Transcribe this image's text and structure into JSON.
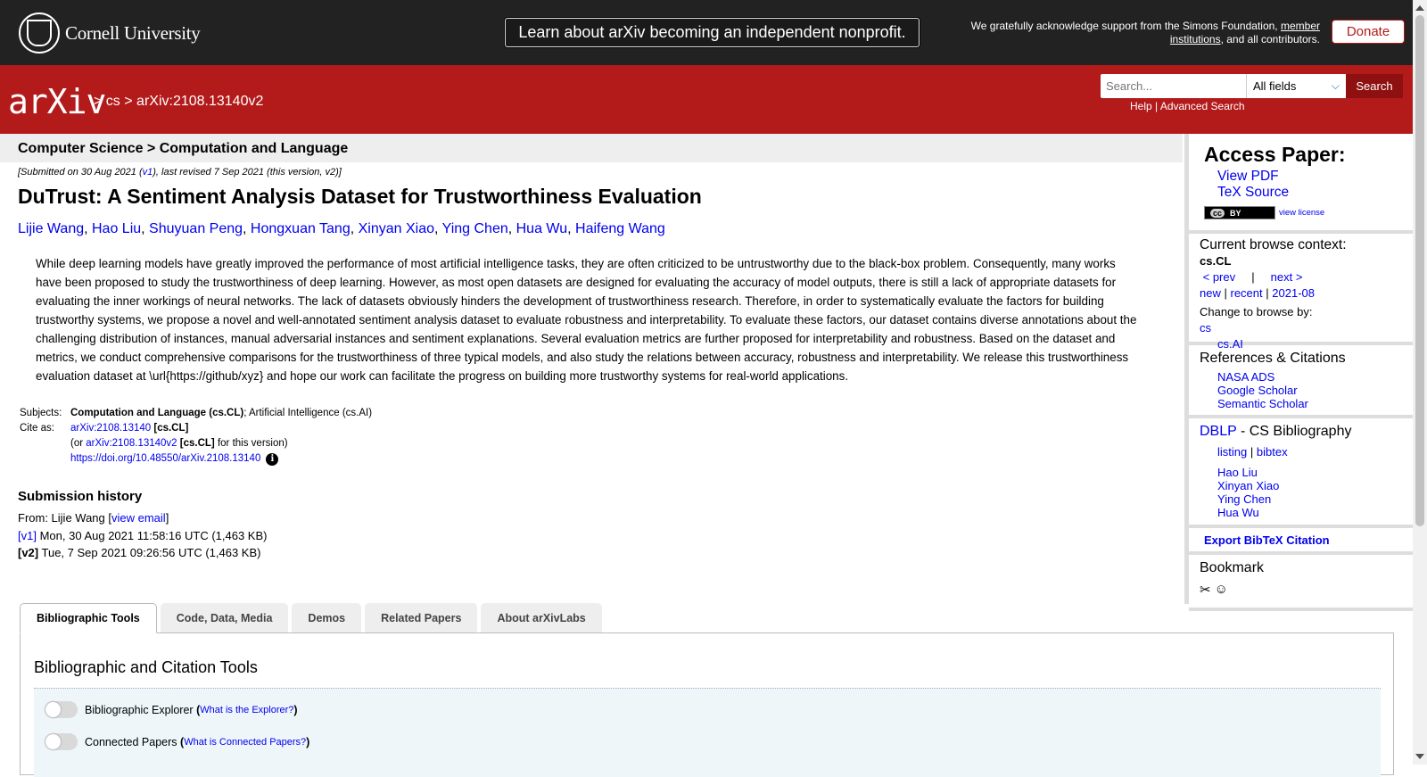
{
  "topbar": {
    "institution": "Cornell University",
    "announcement": "Learn about arXiv becoming an independent nonprofit.",
    "support_text_pre": "We gratefully acknowledge support from the Simons Foundation,",
    "support_link": "member institutions",
    "support_text_post": ", and all contributors.",
    "donate_label": "Donate"
  },
  "header": {
    "logo_text": "arXiv",
    "crumb_sep1": ">",
    "crumb_cs": "cs",
    "crumb_sep2": ">",
    "crumb_id": "arXiv:2108.13140v2",
    "search_placeholder": "Search...",
    "search_field": "All fields",
    "search_button": "Search",
    "help": "Help",
    "sep": "|",
    "advanced": "Advanced Search"
  },
  "paper": {
    "subject_path": "Computer Science > Computation and Language",
    "submitted_pre": "[Submitted on 30 Aug 2021 (",
    "submitted_v1": "v1",
    "submitted_post": "), last revised 7 Sep 2021 (this version, v2)]",
    "title": "DuTrust: A Sentiment Analysis Dataset for Trustworthiness Evaluation",
    "authors": [
      "Lijie Wang",
      "Hao Liu",
      "Shuyuan Peng",
      "Hongxuan Tang",
      "Xinyan Xiao",
      "Ying Chen",
      "Hua Wu",
      "Haifeng Wang"
    ],
    "abstract": "While deep learning models have greatly improved the performance of most artificial intelligence tasks, they are often criticized to be untrustworthy due to the black-box problem. Consequently, many works have been proposed to study the trustworthiness of deep learning. However, as most open datasets are designed for evaluating the accuracy of model outputs, there is still a lack of appropriate datasets for evaluating the inner workings of neural networks. The lack of datasets obviously hinders the development of trustworthiness research. Therefore, in order to systematically evaluate the factors for building trustworthy systems, we propose a novel and well-annotated sentiment analysis dataset to evaluate robustness and interpretability. To evaluate these factors, our dataset contains diverse annotations about the challenging distribution of instances, manual adversarial instances and sentiment explanations. Several evaluation metrics are further proposed for interpretability and robustness. Based on the dataset and metrics, we conduct comprehensive comparisons for the trustworthiness of three typical models, and also study the relations between accuracy, robustness and interpretability. We release this trustworthiness evaluation dataset at \\url{https://github/xyz} and hope our work can facilitate the progress on building more trustworthy systems for real-world applications.",
    "subjects_label": "Subjects:",
    "subjects_primary": "Computation and Language (cs.CL)",
    "subjects_rest": "; Artificial Intelligence (cs.AI)",
    "cite_label": "Cite as:",
    "cite_id": "arXiv:2108.13140",
    "cite_tag": "[cs.CL]",
    "cite_v_pre": "(or",
    "cite_v_id": "arXiv:2108.13140v2",
    "cite_v_tag": "[cs.CL]",
    "cite_v_post": "for this version)",
    "doi": "https://doi.org/10.48550/arXiv.2108.13140",
    "info_glyph": "i"
  },
  "history": {
    "heading": "Submission history",
    "from_pre": "From: Lijie Wang [",
    "from_link": "view email",
    "from_post": "]",
    "v1_tag": "[v1]",
    "v1_text": "Mon, 30 Aug 2021 11:58:16 UTC (1,463 KB)",
    "v2_tag": "[v2]",
    "v2_text": "Tue, 7 Sep 2021 09:26:56 UTC (1,463 KB)"
  },
  "sidebar": {
    "access_heading": "Access Paper:",
    "view_pdf": "View PDF",
    "tex_source": "TeX Source",
    "cc_label": "BY",
    "cc_mark": "cc",
    "view_license": "view license",
    "browse_heading": "Current browse context:",
    "browse_ctx": "cs.CL",
    "prev": "< prev",
    "pipe": "|",
    "next": "next >",
    "new": "new",
    "recent": "recent",
    "date": "2021-08",
    "change_browse": "Change to browse by:",
    "browse_cs": "cs",
    "browse_ai": "cs.AI",
    "refs_heading": "References & Citations",
    "nasa": "NASA ADS",
    "google": "Google Scholar",
    "semantic": "Semantic Scholar",
    "dblp": "DBLP",
    "dblp_rest": " - CS Bibliography",
    "listing": "listing",
    "bibtex": "bibtex",
    "dblp_authors": [
      "Hao Liu",
      "Xinyan Xiao",
      "Ying Chen",
      "Hua Wu"
    ],
    "export_bibtex": "Export BibTeX Citation",
    "bookmark_heading": "Bookmark"
  },
  "tabs": {
    "items": [
      "Bibliographic Tools",
      "Code, Data, Media",
      "Demos",
      "Related Papers",
      "About arXivLabs"
    ],
    "panel_heading": "Bibliographic and Citation Tools",
    "tool1_label": "Bibliographic Explorer",
    "tool1_link": "What is the Explorer?",
    "tool2_label": "Connected Papers",
    "tool2_link": "What is Connected Papers?",
    "paren_open": "(",
    "paren_close": ")"
  },
  "colors": {
    "arxiv_red": "#b31b1b",
    "dark_bar": "#222222",
    "link_blue": "#0000ee"
  }
}
